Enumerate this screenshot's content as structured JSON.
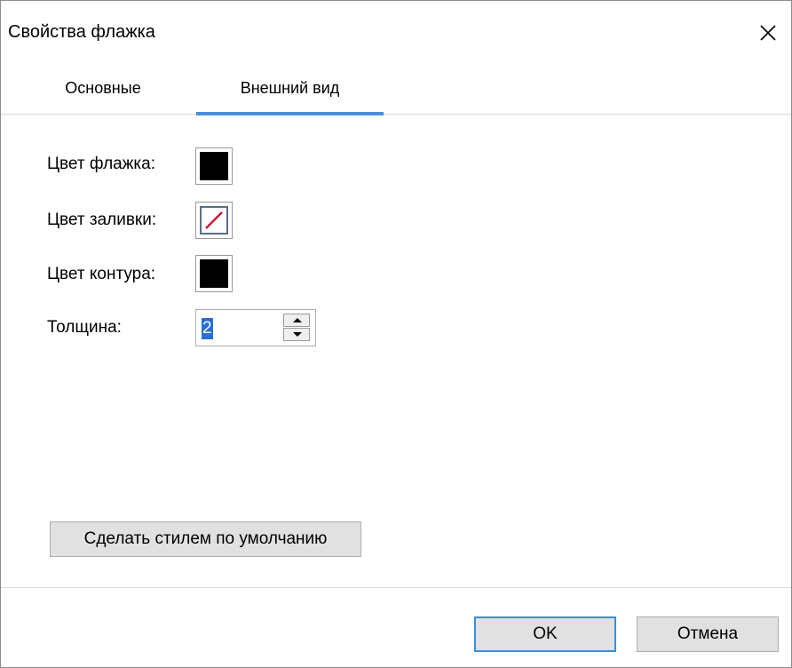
{
  "window": {
    "title": "Свойства флажка",
    "close_icon": "close-icon"
  },
  "tabs": [
    {
      "label": "Основные",
      "active": false
    },
    {
      "label": "Внешний вид",
      "active": true
    }
  ],
  "colors": {
    "accent": "#4a90d9",
    "selection": "#2a6fd6",
    "flag_color": "#000000",
    "outline_color": "#000000",
    "no_fill_slash": "#d0103a"
  },
  "form": {
    "flag_color_label": "Цвет флажка:",
    "fill_color_label": "Цвет заливки:",
    "fill_color_value": "none",
    "outline_color_label": "Цвет контура:",
    "thickness_label": "Толщина:",
    "thickness_value": "2"
  },
  "buttons": {
    "make_default": "Сделать стилем по умолчанию",
    "ok": "OK",
    "cancel": "Отмена"
  }
}
